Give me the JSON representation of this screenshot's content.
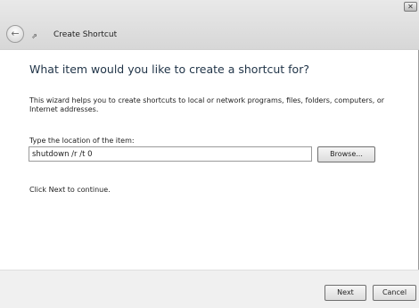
{
  "window": {
    "title": "Create Shortcut",
    "close_icon": "close-icon",
    "back_icon": "back-arrow-icon",
    "app_icon": "shortcut-icon"
  },
  "main": {
    "heading": "What item would you like to create a shortcut for?",
    "description": "This wizard helps you to create shortcuts to local or network programs, files, folders, computers, or Internet addresses.",
    "location_label": "Type the location of the item:",
    "location_value": "shutdown /r /t 0",
    "browse_label": "Browse...",
    "continue_text": "Click Next to continue."
  },
  "footer": {
    "next_label": "Next",
    "cancel_label": "Cancel"
  },
  "colors": {
    "heading": "#1f3347",
    "footer_bg": "#f0f0f0"
  }
}
